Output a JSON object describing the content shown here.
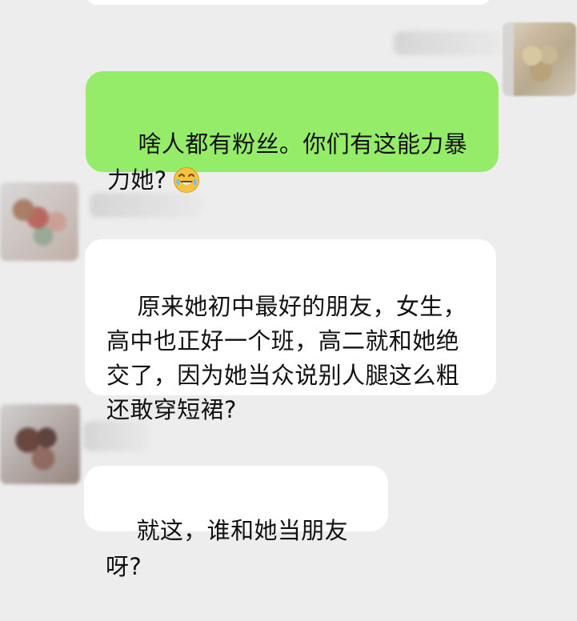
{
  "messages": [
    {
      "side": "right",
      "text": "啥人都有粉丝。你们有这能力暴力她?",
      "emoji": "😂"
    },
    {
      "side": "left",
      "text": "原来她初中最好的朋友，女生，高中也正好一个班，高二就和她绝交了，因为她当众说别人腿这么粗还敢穿短裙?"
    },
    {
      "side": "left",
      "text": "就这，谁和她当朋友呀?"
    }
  ],
  "colors": {
    "background": "#ededed",
    "sent_bubble": "#95ec69",
    "received_bubble": "#ffffff",
    "text": "#111111"
  }
}
